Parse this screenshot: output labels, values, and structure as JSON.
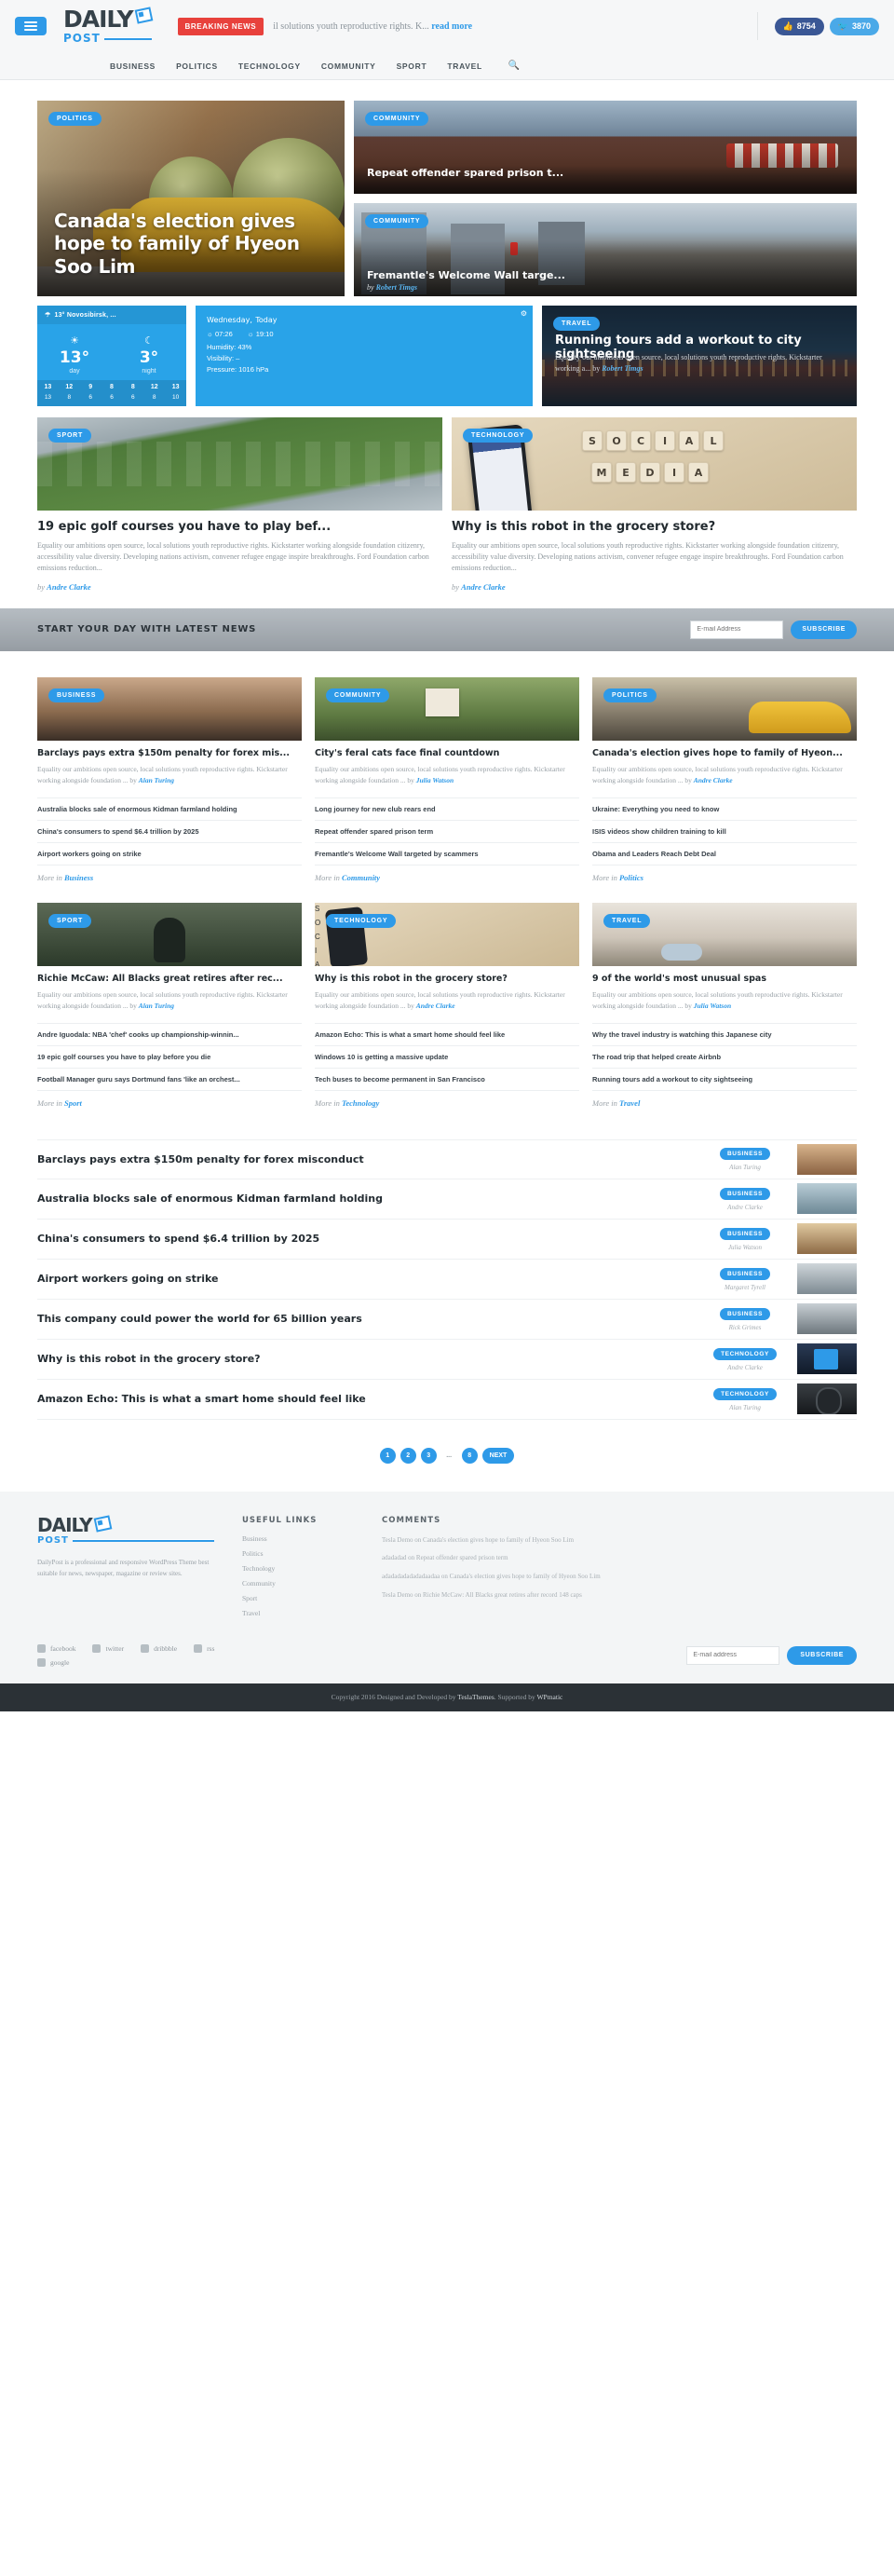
{
  "header": {
    "logo_main": "DAILY",
    "logo_sub": "POST",
    "breaking_label": "BREAKING NEWS",
    "breaking_text": "il solutions youth reproductive rights. K...",
    "breaking_link": "read more",
    "facebook_count": "8754",
    "twitter_count": "3870",
    "menu_icon": "hamburger-icon"
  },
  "nav": {
    "items": [
      "BUSINESS",
      "POLITICS",
      "TECHNOLOGY",
      "COMMUNITY",
      "SPORT",
      "TRAVEL"
    ],
    "search_icon": "search-icon"
  },
  "hero": {
    "main": {
      "category": "POLITICS",
      "title": "Canada's election gives hope to family of Hyeon Soo Lim"
    },
    "side": [
      {
        "category": "COMMUNITY",
        "title": "Repeat offender spared prison t...",
        "author": ""
      },
      {
        "category": "COMMUNITY",
        "title": "Fremantle's Welcome Wall targe...",
        "author": "Robert Timgs"
      }
    ]
  },
  "weather": {
    "location": "13° Novosibirsk, ...",
    "settings_icon": "gear-icon",
    "day_temp": "13°",
    "day_label": "day",
    "night_temp": "3°",
    "night_label": "night",
    "headline_day": "Wednesday,",
    "headline_today": "Today",
    "sunrise": "07:26",
    "sunset": "19:10",
    "humidity": "Humidity: 43%",
    "visibility": "Visibility: –",
    "pressure": "Pressure: 1016 hPa",
    "forecast": [
      {
        "day": "13",
        "n": "13"
      },
      {
        "day": "12",
        "n": "8"
      },
      {
        "day": "9",
        "n": "6"
      },
      {
        "day": "8",
        "n": "6"
      },
      {
        "day": "8",
        "n": "6"
      },
      {
        "day": "12",
        "n": "8"
      },
      {
        "day": "13",
        "n": "10"
      }
    ]
  },
  "travel_feature": {
    "category": "TRAVEL",
    "title": "Running tours add a workout to city sightseeing",
    "excerpt": "Equality our ambitions open source, local solutions youth reproductive rights. Kickstarter working a...",
    "by": "by",
    "author": "Robert Timgs"
  },
  "features": [
    {
      "category": "SPORT",
      "title": "19 epic golf courses you have to play bef...",
      "excerpt": "Equality our ambitions open source, local solutions youth reproductive rights. Kickstarter working alongside foundation citizenry, accessibility value diversity. Developing nations activism, convener refugee engage inspire breakthroughs. Ford Foundation carbon emissions reduction...",
      "by": "by",
      "author": "Andre Clarke"
    },
    {
      "category": "TECHNOLOGY",
      "title": "Why is this robot in the grocery store?",
      "excerpt": "Equality our ambitions open source, local solutions youth reproductive rights. Kickstarter working alongside foundation citizenry, accessibility value diversity. Developing nations activism, convener refugee engage inspire breakthroughs. Ford Foundation carbon emissions reduction...",
      "by": "by",
      "author": "Andre Clarke"
    }
  ],
  "subscribe": {
    "title": "START YOUR DAY WITH LATEST NEWS",
    "placeholder": "E-mail Address",
    "button": "SUBSCRIBE"
  },
  "blocks": [
    {
      "category": "BUSINESS",
      "title": "Barclays pays extra $150m penalty for forex mis...",
      "excerpt": "Equality our ambitions open source, local solutions youth reproductive rights. Kickstarter working alongside foundation ...",
      "by": "by",
      "author": "Alan Turing",
      "items": [
        "Australia blocks sale of enormous Kidman farmland holding",
        "China's consumers to spend $6.4 trillion by 2025",
        "Airport workers going on strike"
      ],
      "more_prefix": "More in ",
      "more": "Business"
    },
    {
      "category": "COMMUNITY",
      "title": "City's feral cats face final countdown",
      "excerpt": "Equality our ambitions open source, local solutions youth reproductive rights. Kickstarter working alongside foundation ...",
      "by": "by",
      "author": "Julia Watson",
      "items": [
        "Long journey for new club rears end",
        "Repeat offender spared prison term",
        "Fremantle's Welcome Wall targeted by scammers"
      ],
      "more_prefix": "More in ",
      "more": "Community"
    },
    {
      "category": "POLITICS",
      "title": "Canada's election gives hope to family of Hyeon...",
      "excerpt": "Equality our ambitions open source, local solutions youth reproductive rights. Kickstarter working alongside foundation ...",
      "by": "by",
      "author": "Andre Clarke",
      "items": [
        "Ukraine: Everything you need to know",
        "ISIS videos show children training to kill",
        "Obama and Leaders Reach Debt Deal"
      ],
      "more_prefix": "More in ",
      "more": "Politics"
    },
    {
      "category": "SPORT",
      "title": "Richie McCaw: All Blacks great retires after rec...",
      "excerpt": "Equality our ambitions open source, local solutions youth reproductive rights. Kickstarter working alongside foundation ...",
      "by": "by",
      "author": "Alan Turing",
      "items": [
        "Andre Iguodala: NBA 'chef' cooks up championship-winnin...",
        "19 epic golf courses you have to play before you die",
        "Football Manager guru says Dortmund fans 'like an orchest..."
      ],
      "more_prefix": "More in ",
      "more": "Sport"
    },
    {
      "category": "TECHNOLOGY",
      "title": "Why is this robot in the grocery store?",
      "excerpt": "Equality our ambitions open source, local solutions youth reproductive rights. Kickstarter working alongside foundation ...",
      "by": "by",
      "author": "Andre Clarke",
      "items": [
        "Amazon Echo: This is what a smart home should feel like",
        "Windows 10 is getting a massive update",
        "Tech buses to become permanent in San Francisco"
      ],
      "more_prefix": "More in ",
      "more": "Technology"
    },
    {
      "category": "TRAVEL",
      "title": "9 of the world's most unusual spas",
      "excerpt": "Equality our ambitions open source, local solutions youth reproductive rights. Kickstarter working alongside foundation ...",
      "by": "by",
      "author": "Julia Watson",
      "items": [
        "Why the travel industry is watching this Japanese city",
        "The road trip that helped create Airbnb",
        "Running tours add a workout to city sightseeing"
      ],
      "more_prefix": "More in ",
      "more": "Travel"
    }
  ],
  "list": [
    {
      "title": "Barclays pays extra $150m penalty for forex misconduct",
      "category": "BUSINESS",
      "author": "Alan Turing"
    },
    {
      "title": "Australia blocks sale of enormous Kidman farmland holding",
      "category": "BUSINESS",
      "author": "Andre Clarke"
    },
    {
      "title": "China's consumers to spend $6.4 trillion by 2025",
      "category": "BUSINESS",
      "author": "Julia Watson"
    },
    {
      "title": "Airport workers going on strike",
      "category": "BUSINESS",
      "author": "Margaret Tyrell"
    },
    {
      "title": "This company could power the world for 65 billion years",
      "category": "BUSINESS",
      "author": "Rick Grimes"
    },
    {
      "title": "Why is this robot in the grocery store?",
      "category": "TECHNOLOGY",
      "author": "Andre Clarke"
    },
    {
      "title": "Amazon Echo: This is what a smart home should feel like",
      "category": "TECHNOLOGY",
      "author": "Alan Turing"
    }
  ],
  "pagination": {
    "pages": [
      "1",
      "2",
      "3"
    ],
    "ellipsis": "...",
    "last": "8",
    "next": "NEXT"
  },
  "footer": {
    "logo_main": "DAILY",
    "logo_sub": "POST",
    "description": "DailyPost is a professional and responsive WordPress Theme best suitable for news, newspaper, magazine or review sites.",
    "links_heading": "USEFUL LINKS",
    "links": [
      "Business",
      "Politics",
      "Technology",
      "Community",
      "Sport",
      "Travel"
    ],
    "comments_heading": "COMMENTS",
    "comments": [
      "Tesla Demo on Canada's election gives hope to family of Hyeon Soo Lim",
      "adadadad on Repeat offender spared prison term",
      "adadadadadadadaadaa on Canada's election gives hope to family of Hyeon Soo Lim",
      "Tesla Demo on Richie McCaw: All Blacks great retires after record 148 caps"
    ],
    "social": [
      {
        "name": "facebook",
        "icon": "facebook-icon"
      },
      {
        "name": "twitter",
        "icon": "twitter-icon"
      },
      {
        "name": "dribbble",
        "icon": "dribbble-icon"
      },
      {
        "name": "rss",
        "icon": "rss-icon"
      },
      {
        "name": "google",
        "icon": "google-icon"
      }
    ],
    "sub_placeholder": "E-mail address",
    "sub_button": "SUBSCRIBE",
    "copyright_pre": "Copyright 2016 Designed and Developed by ",
    "copyright_brand": "TeslaThemes",
    "copyright_mid": ". Supported by ",
    "copyright_brand2": "WPmatic"
  },
  "colors": {
    "accent": "#2e9ae8",
    "breaking": "#e8413c",
    "dark": "#2b3136"
  }
}
